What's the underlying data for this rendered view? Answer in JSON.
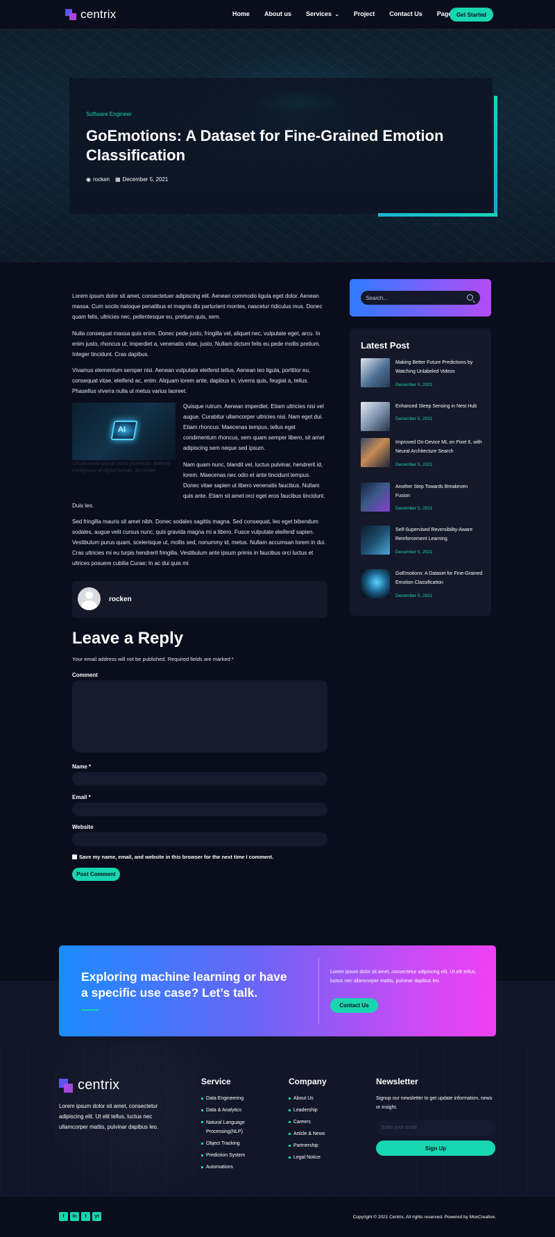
{
  "header": {
    "logo_text": "centrix",
    "nav": [
      "Home",
      "About us",
      "Services",
      "Project",
      "Contact Us",
      "Page"
    ],
    "cta_label": "Get Started"
  },
  "hero": {
    "tag": "Software Engineer",
    "title": "GoEmotions: A Dataset for Fine-Grained Emotion Classification",
    "author": "rocken",
    "date": "December 5, 2021"
  },
  "article": {
    "p1": "Lorem ipsum dolor sit amet, consectetuer adipiscing elit. Aenean commodo ligula eget dolor. Aenean massa. Cum sociis natoque penatibus et magnis dis parturient montes, nascetur ridiculus mus. Donec quam felis, ultricies nec, pellentesque eu, pretium quis, sem.",
    "p2": "Nulla consequat massa quis enim. Donec pede justo, fringilla vel, aliquet nec, vulputate eget, arcu. In enim justo, rhoncus ut, imperdiet a, venenatis vitae, justo. Nullam dictum felis eu pede mollis pretium. Integer tincidunt. Cras dapibus.",
    "p3": "Vivamus elementum semper nisi. Aenean vulputate eleifend tellus. Aenean leo ligula, porttitor eu, consequat vitae, eleifend ac, enim. Aliquam lorem ante, dapibus in, viverra quis, feugiat a, tellus. Phasellus viverra nulla ut metus varius laoreet.",
    "p4": "Quisque rutrum. Aenean imperdiet. Etiam ultricies nisi vel augue. Curabitur ullamcorper ultricies nisi. Nam eget dui. Etiam rhoncus. Maecenas tempus, tellus eget condimentum rhoncus, sem quam semper libero, sit amet adipiscing sem neque sed ipsum.",
    "p5a": "Nam quam nunc, blandit vel, luctus pulvinar, hendrerit id, lorem. Maecenas nec odio et ante tincidunt tempus. Donec vitae sapien ut libero venenatis faucibus. Nullam quis ante. Etiam sit amet orci eget eros faucibus tincidunt.",
    "p5b": "Duis leo.",
    "p6": "Sed fringilla mauris sit amet nibh. Donec sodales sagittis magna. Sed consequat, leo eget bibendum sodales, augue velit cursus nunc, quis gravida magna mi a libero. Fusce vulputate eleifend sapien. Vestibulum purus quam, scelerisque ut, mollis sed, nonummy id, metus. Nullam accumsan lorem in dui. Cras ultricies mi eu turpis hendrerit fringilla. Vestibulum ante ipsum primis in faucibus orci luctus et ultrices posuere cubilia Curae; In ac dui quis mi",
    "figure_text": "AI",
    "figure_caption": "Circuit board and AI micro processor, Artificial intelligence of digital human. 3d render",
    "author_name": "rocken"
  },
  "reply": {
    "title": "Leave a Reply",
    "note": "Your email address will not be published. Required fields are marked *",
    "comment_label": "Comment",
    "name_label": "Name *",
    "email_label": "Email *",
    "website_label": "Website",
    "save_label": "Save my name, email, and website in this browser for the next time I comment.",
    "submit_label": "Post Comment"
  },
  "sidebar": {
    "search_placeholder": "Search...",
    "latest_title": "Latest Post",
    "posts": [
      {
        "title": "Making Better Future Predictions by Watching Unlabeled Videos",
        "date": "December 5, 2021"
      },
      {
        "title": "Enhanced Sleep Sensing in Nest Hub",
        "date": "December 5, 2021"
      },
      {
        "title": "Improved On-Device ML on Pixel 6, with Neural Architecture Search",
        "date": "December 5, 2021"
      },
      {
        "title": "Another Step Towards Breakeven Fusion",
        "date": "December 5, 2021"
      },
      {
        "title": "Self-Supervised Reversibility-Aware Reinforcement Learning",
        "date": "December 5, 2021"
      },
      {
        "title": "GoEmotions: A Dataset for Fine-Grained Emotion Classification",
        "date": "December 5, 2021"
      }
    ]
  },
  "cta": {
    "title": "Exploring machine learning or have a specific use case? Let’s talk.",
    "text": "Lorem ipsum dolor sit amet, consectetur adipiscing elit. Ut elit tellus, luctus nec ullamcorper mattis, pulvinar dapibus leo.",
    "button": "Contact Us"
  },
  "footer": {
    "logo_text": "centrix",
    "about": "Lorem ipsum dolor sit amet, consectetur adipiscing elit. Ut elit tellus, luctus nec ullamcorper mattis, pulvinar dapibus leo.",
    "service_title": "Service",
    "services": [
      "Data Engineering",
      "Data & Analytics",
      "Natural Language Processing(NLP)",
      "Object Tracking",
      "Prediction System",
      "Automations"
    ],
    "company_title": "Company",
    "company": [
      "About Us",
      "Leadership",
      "Careers",
      "Article & News",
      "Partnership",
      "Legal Notice"
    ],
    "newsletter_title": "Newsletter",
    "newsletter_text": "Signup our newsletter to get update information, news or insight.",
    "newsletter_placeholder": "Enter your email",
    "newsletter_button": "Sign Up",
    "social": [
      "f",
      "in",
      "t",
      "yt"
    ],
    "copyright": "Copyright © 2021 Centrix, All rights reserved. Powered by MoxCreative."
  },
  "colors": {
    "accent": "#18d6b0",
    "background": "#0a0d1c",
    "gradient_start": "#1b8bff",
    "gradient_end": "#f040f3"
  }
}
